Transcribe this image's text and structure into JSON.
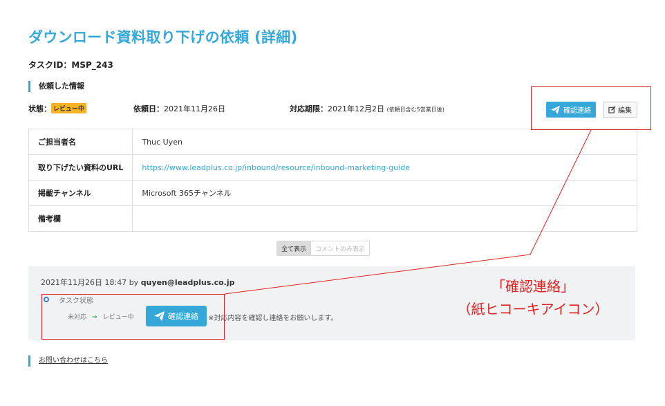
{
  "page": {
    "title": "ダウンロード資料取り下げの依頼 (詳細)",
    "task_id": "タスクID：MSP_243"
  },
  "section": {
    "label": "依頼した情報"
  },
  "status": {
    "label": "状態：",
    "badge": "レビュー中",
    "request_date_label": "依頼日：",
    "request_date": "2021年11月26日",
    "deadline_label": "対応期限：",
    "deadline": "2021年12月2日",
    "deadline_note": "(依頼日含む5営業日後)"
  },
  "actions": {
    "confirm_label": "確認連絡",
    "edit_label": "編集"
  },
  "info_table": {
    "rows": [
      {
        "key": "ご担当者名",
        "value": "Thuc Uyen"
      },
      {
        "key": "取り下げたい資料のURL",
        "value": "https://www.leadplus.co.jp/inbound/resource/inbound-marketing-guide"
      },
      {
        "key": "掲載チャンネル",
        "value": "Microsoft 365チャンネル"
      },
      {
        "key": "備考欄",
        "value": ""
      }
    ]
  },
  "filter": {
    "show_all": "全て表示",
    "comments_only": "コメントのみ表示"
  },
  "comment": {
    "datetime": "2021年11月26日 18:47",
    "by": "by",
    "user": "quyen@leadplus.co.jp",
    "state_title": "タスク状態",
    "from_state": "未対応",
    "arrow": "→",
    "to_state": "レビュー中",
    "button_label": "確認連絡",
    "note": "※対応内容を確認し連絡をお願いします。"
  },
  "footer": {
    "contact_link": "お問い合わせはこちら"
  },
  "annotation": {
    "line1": "「確認連絡」",
    "line2": "（紙ヒコーキアイコン）",
    "color": "#e02020"
  },
  "colors": {
    "accent": "#35a8d9",
    "badge": "#f5b325",
    "flow_arrow": "#2fae4f"
  }
}
